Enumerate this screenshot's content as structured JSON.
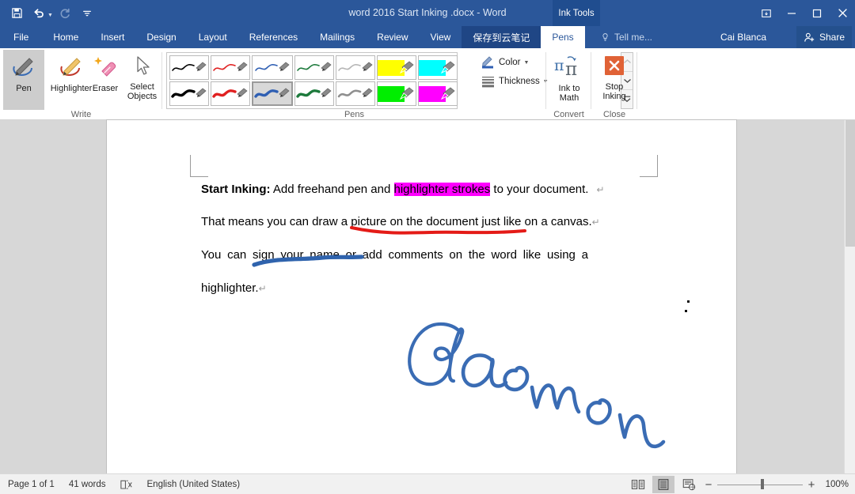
{
  "window": {
    "title": "word 2016 Start Inking .docx - Word",
    "contextual_tab": "Ink Tools",
    "accent_color": "#2b579a",
    "quick_access": [
      {
        "name": "save",
        "icon": "save-icon"
      },
      {
        "name": "undo",
        "icon": "undo-icon"
      },
      {
        "name": "redo",
        "icon": "redo-icon"
      },
      {
        "name": "customize",
        "icon": "customize-quick-access-icon"
      }
    ],
    "controls": [
      {
        "name": "ribbon-display-options",
        "icon": "ribbon-display-options-icon"
      },
      {
        "name": "minimize",
        "icon": "minimize-icon"
      },
      {
        "name": "restore",
        "icon": "restore-icon"
      },
      {
        "name": "close",
        "icon": "close-icon"
      }
    ]
  },
  "ribbon": {
    "tabs": [
      {
        "label": "File",
        "active": false
      },
      {
        "label": "Home",
        "active": false
      },
      {
        "label": "Insert",
        "active": false
      },
      {
        "label": "Design",
        "active": false
      },
      {
        "label": "Layout",
        "active": false
      },
      {
        "label": "References",
        "active": false
      },
      {
        "label": "Mailings",
        "active": false
      },
      {
        "label": "Review",
        "active": false
      },
      {
        "label": "View",
        "active": false
      },
      {
        "label": "保存到云笔记",
        "active": false
      },
      {
        "label": "Pens",
        "active": true
      }
    ],
    "tell_me": "Tell me...",
    "user_name": "Cai Blanca",
    "share_label": "Share",
    "collapse_icon": "chevron-up-icon",
    "groups": {
      "write": {
        "label": "Write",
        "buttons": [
          {
            "label": "Pen",
            "selected": true,
            "icon": "pen-icon"
          },
          {
            "label": "Highlighter",
            "selected": false,
            "icon": "highlighter-icon"
          },
          {
            "label": "Eraser",
            "selected": false,
            "icon": "eraser-icon"
          },
          {
            "label": "Select\nObjects",
            "line1": "Select",
            "line2": "Objects",
            "selected": false,
            "icon": "cursor-arrow-icon"
          }
        ]
      },
      "pens": {
        "label": "Pens",
        "swatches": [
          {
            "name": "pen-black-thin",
            "color": "#000000",
            "kind": "pen",
            "weight": 2,
            "selected": false
          },
          {
            "name": "pen-red-thin",
            "color": "#e02020",
            "kind": "pen",
            "weight": 2,
            "selected": false
          },
          {
            "name": "pen-blue-thin",
            "color": "#2f5fb3",
            "kind": "pen",
            "weight": 2,
            "selected": false
          },
          {
            "name": "pen-green-thin",
            "color": "#1d7a3c",
            "kind": "pen",
            "weight": 2,
            "selected": false
          },
          {
            "name": "pen-gray-thin",
            "color": "#a0a0a0",
            "kind": "pen",
            "weight": 2,
            "selected": false
          },
          {
            "name": "highlighter-yellow",
            "color": "#ffff00",
            "kind": "highlighter",
            "weight": 0,
            "selected": false
          },
          {
            "name": "highlighter-cyan",
            "color": "#00ffff",
            "kind": "highlighter",
            "weight": 0,
            "selected": false
          },
          {
            "name": "pen-black-thick",
            "color": "#000000",
            "kind": "pen",
            "weight": 5,
            "selected": false
          },
          {
            "name": "pen-red-thick",
            "color": "#e02020",
            "kind": "pen",
            "weight": 5,
            "selected": false
          },
          {
            "name": "pen-blue-thick",
            "color": "#2f5fb3",
            "kind": "pen",
            "weight": 5,
            "selected": true
          },
          {
            "name": "pen-green-thick",
            "color": "#1d7a3c",
            "kind": "pen",
            "weight": 5,
            "selected": false
          },
          {
            "name": "pen-gray-thick",
            "color": "#8f8f8f",
            "kind": "pen",
            "weight": 4,
            "selected": false
          },
          {
            "name": "highlighter-green",
            "color": "#00ee00",
            "kind": "highlighter",
            "weight": 0,
            "selected": false
          },
          {
            "name": "highlighter-magenta",
            "color": "#ff00ff",
            "kind": "highlighter",
            "weight": 0,
            "selected": false
          }
        ],
        "scroll_up": "scroll-up-icon",
        "scroll_down": "scroll-down-icon",
        "more": "more-icon",
        "color_label": "Color",
        "thickness_label": "Thickness"
      },
      "convert": {
        "label": "Convert",
        "button_line1": "Ink to",
        "button_line2": "Math",
        "icon": "ink-to-math-icon"
      },
      "close": {
        "label": "Close",
        "button_line1": "Stop",
        "button_line2": "Inking",
        "icon": "stop-inking-icon",
        "icon_color": "#e06236"
      }
    }
  },
  "document": {
    "paragraphs": [
      {
        "name": "paragraph-start-inking",
        "bold_lead": "Start Inking:",
        "text_before": " Add freehand pen and ",
        "highlighted": "highlighter strokes",
        "highlight_color": "#ff00ff",
        "text_after": " to your document.",
        "pilcrow": "↵"
      },
      {
        "name": "paragraph-canvas",
        "text": "That means you can draw a picture on the document just like on a canvas.",
        "pilcrow": "↵",
        "ink_annotation": "red-underline"
      },
      {
        "name": "paragraph-sign",
        "text": "You can sign your name or add comments on the word like using a",
        "ink_annotation": "blue-underline"
      },
      {
        "name": "paragraph-sign-continued",
        "text": "highlighter.",
        "pilcrow": "↵"
      }
    ],
    "ink_strokes": [
      {
        "name": "red-underline-ink",
        "color": "#e41b17"
      },
      {
        "name": "blue-underline-ink",
        "color": "#2f63ad"
      },
      {
        "name": "signature-ink",
        "color": "#3a6cb4",
        "text": "Gaomon"
      },
      {
        "name": "stray-ink-dot-1",
        "color": "#111111"
      },
      {
        "name": "stray-ink-dot-2",
        "color": "#111111"
      }
    ]
  },
  "status_bar": {
    "page_info": "Page 1 of 1",
    "word_count": "41 words",
    "proofing_icon": "proofing-errors-icon",
    "language": "English (United States)",
    "views": [
      {
        "name": "read-mode",
        "icon": "read-mode-icon",
        "selected": false
      },
      {
        "name": "print-layout",
        "icon": "print-layout-icon",
        "selected": true
      },
      {
        "name": "web-layout",
        "icon": "web-layout-icon",
        "selected": false
      }
    ],
    "zoom_out": "−",
    "zoom_in": "+",
    "zoom_level": "100%"
  }
}
